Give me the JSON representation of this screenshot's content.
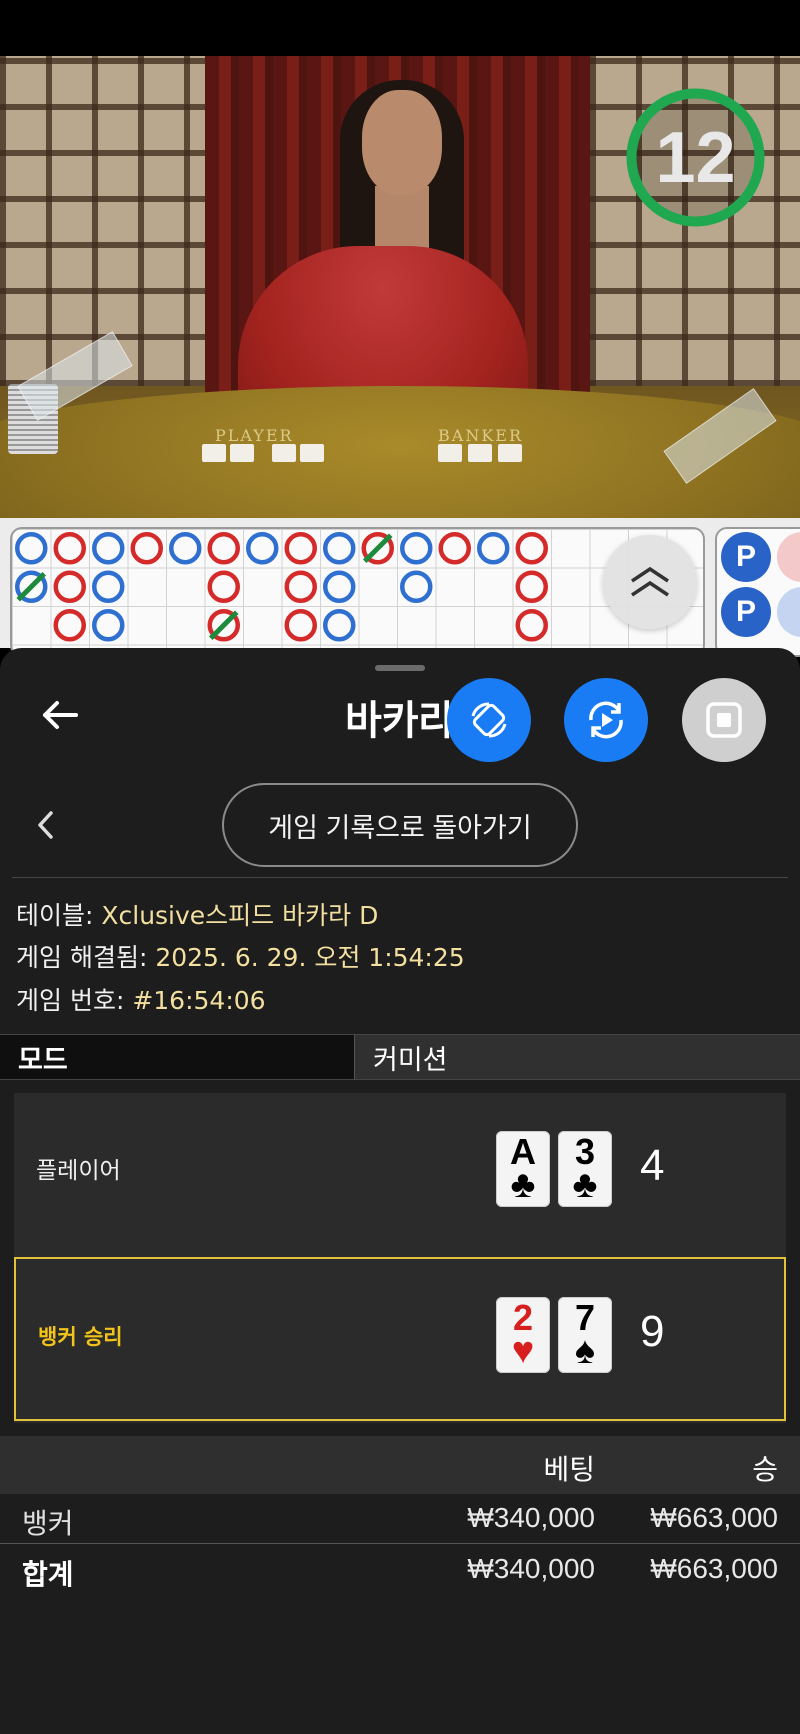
{
  "video": {
    "felt_player_label": "PLAYER",
    "felt_banker_label": "BANKER",
    "timer": "12",
    "timer_color": "#1fa84f"
  },
  "roadmap": {
    "player_color": "#2f6fd0",
    "banker_color": "#d42a2a",
    "tie_color": "#1e8a3c",
    "side_pills": [
      "P",
      "P"
    ]
  },
  "sheet": {
    "title": "바카라",
    "back_icon": "arrow-left-icon",
    "history_button": "게임 기록으로 돌아가기"
  },
  "info": {
    "table_label": "테이블: ",
    "table_value": "Xclusive스피드 바카라 D",
    "resolved_label": "게임 해결됨: ",
    "resolved_value": "2025. 6. 29. 오전 1:54:25",
    "number_label": "게임 번호: ",
    "number_value": "#16:54:06"
  },
  "tabs": {
    "mode": "모드",
    "commission": "커미션"
  },
  "results": {
    "player": {
      "label": "플레이어",
      "cards": [
        {
          "rank": "A",
          "suit": "♣"
        },
        {
          "rank": "3",
          "suit": "♣"
        }
      ],
      "score": "4"
    },
    "banker": {
      "label": "뱅커 승리",
      "cards": [
        {
          "rank": "2",
          "suit": "♥"
        },
        {
          "rank": "7",
          "suit": "♠"
        }
      ],
      "score": "9"
    }
  },
  "bets": {
    "header_bet": "베팅",
    "header_win": "승",
    "rows": [
      {
        "name": "뱅커",
        "bet": "₩340,000",
        "win": "₩663,000"
      }
    ],
    "total": {
      "name": "합계",
      "bet": "₩340,000",
      "win": "₩663,000"
    }
  }
}
